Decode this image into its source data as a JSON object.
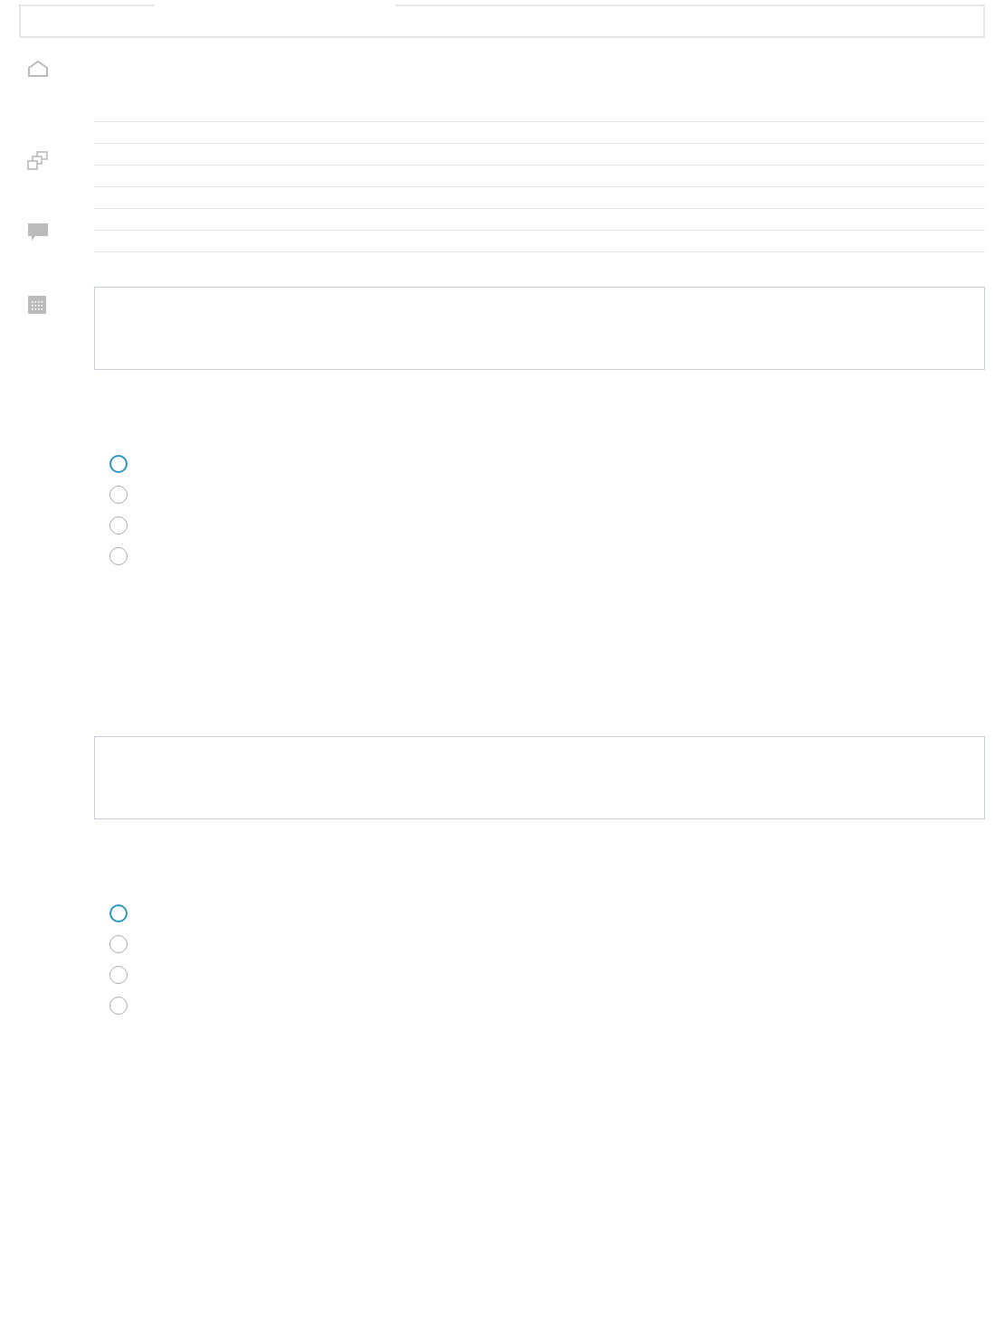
{
  "sidebar": {
    "icons": [
      {
        "kind": "home"
      },
      {
        "kind": "windows"
      },
      {
        "kind": "comment"
      },
      {
        "kind": "calendar"
      }
    ]
  },
  "questions": [
    {
      "answer_box": {
        "kind": "textarea"
      },
      "options": [
        {
          "selected": false,
          "color": "#2a95c2"
        },
        {
          "selected": false,
          "color": "#aaaaaa"
        },
        {
          "selected": false,
          "color": "#aaaaaa"
        },
        {
          "selected": false,
          "color": "#aaaaaa"
        }
      ]
    },
    {
      "answer_box": {
        "kind": "textarea"
      },
      "options": [
        {
          "selected": false,
          "color": "#2a95c2"
        },
        {
          "selected": false,
          "color": "#aaaaaa"
        },
        {
          "selected": false,
          "color": "#aaaaaa"
        },
        {
          "selected": false,
          "color": "#aaaaaa"
        }
      ]
    }
  ]
}
